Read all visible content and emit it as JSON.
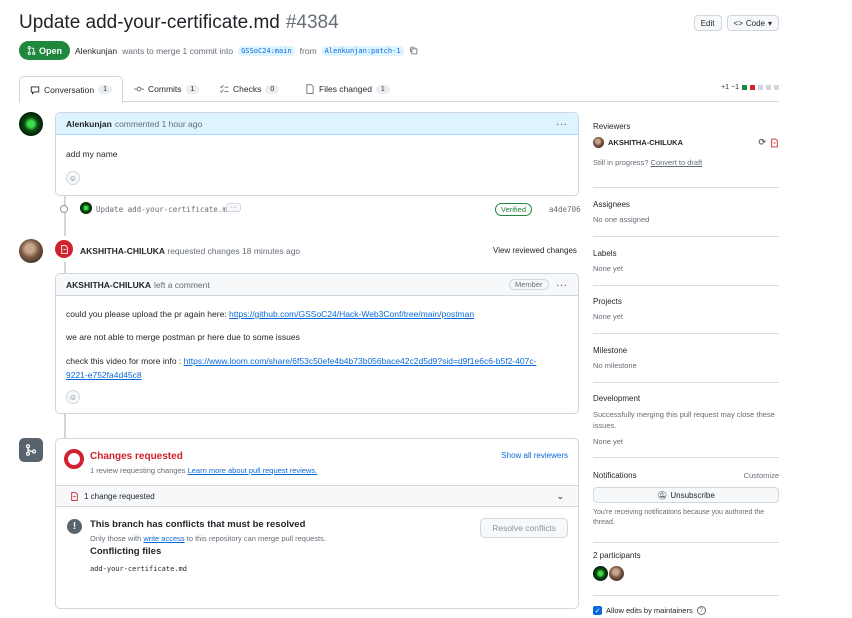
{
  "header": {
    "title": "Update add-your-certificate.md",
    "number": "#4384",
    "edit_label": "Edit",
    "code_label": "Code"
  },
  "state": {
    "badge": "Open",
    "author": "Alenkunjan",
    "text_merge": "wants to merge 1 commit into",
    "base_branch": "GSSoC24:main",
    "from": "from",
    "head_branch": "Alenkunjan:patch-1"
  },
  "tabs": [
    {
      "label": "Conversation",
      "count": "1"
    },
    {
      "label": "Commits",
      "count": "1"
    },
    {
      "label": "Checks",
      "count": "0"
    },
    {
      "label": "Files changed",
      "count": "1"
    }
  ],
  "diffstat": {
    "text": "+1 −1"
  },
  "comment1": {
    "author": "Alenkunjan",
    "meta": "commented 1 hour ago",
    "body": "add my name"
  },
  "commit": {
    "message": "Update add-your-certificate.md",
    "verified": "Verified",
    "sha": "a4de706"
  },
  "review": {
    "reviewer": "AKSHITHA-CHILUKA",
    "meta": "requested changes 18 minutes ago",
    "view_link": "View reviewed changes",
    "comment_author": "AKSHITHA-CHILUKA",
    "comment_meta": "left a comment",
    "member_badge": "Member",
    "line1_prefix": "could you please upload the pr again here: ",
    "line1_link": "https://github.com/GSSoC24/Hack-Web3Conf/tree/main/postman",
    "line2": "we are not able to merge postman pr here due to some issues",
    "line3_prefix": "check this video for more info : ",
    "line3_link_a": "https://www.loom.com/share/6f53c50efe4b4b73b056bace42c2d5d9?sid=d9f1e6c6-b5f2-407c-",
    "line3_link_b": "9221-e752fa4d45c8"
  },
  "merge_box": {
    "title": "Changes requested",
    "sub_prefix": "1 review requesting changes",
    "sub_link": "Learn more about pull request reviews.",
    "show_all": "Show all reviewers",
    "change_row": "1 change requested",
    "conflict_title": "This branch has conflicts that must be resolved",
    "conflict_sub_a": "Only those with",
    "conflict_sub_link": "write access",
    "conflict_sub_b": "to this repository can merge pull requests.",
    "resolve_btn": "Resolve conflicts",
    "conflicting_files": "Conflicting files",
    "file": "add-your-certificate.md"
  },
  "sidebar": {
    "reviewers_h": "Reviewers",
    "reviewer_name": "AKSHITHA-CHILUKA",
    "in_progress": "Still in progress?",
    "convert_draft": "Convert to draft",
    "assignees_h": "Assignees",
    "assignees_v": "No one assigned",
    "labels_h": "Labels",
    "labels_v": "None yet",
    "projects_h": "Projects",
    "projects_v": "None yet",
    "milestone_h": "Milestone",
    "milestone_v": "No milestone",
    "development_h": "Development",
    "development_v": "Successfully merging this pull request may close these issues.",
    "development_v2": "None yet",
    "notifications_h": "Notifications",
    "customize": "Customize",
    "unsubscribe": "Unsubscribe",
    "notif_text": "You're receiving notifications because you authored the thread.",
    "participants_h": "2 participants",
    "allow_edits": "Allow edits by maintainers"
  },
  "colors": {
    "open_green": "#1f883d",
    "danger_red": "#cf222e",
    "link_blue": "#0969da"
  }
}
